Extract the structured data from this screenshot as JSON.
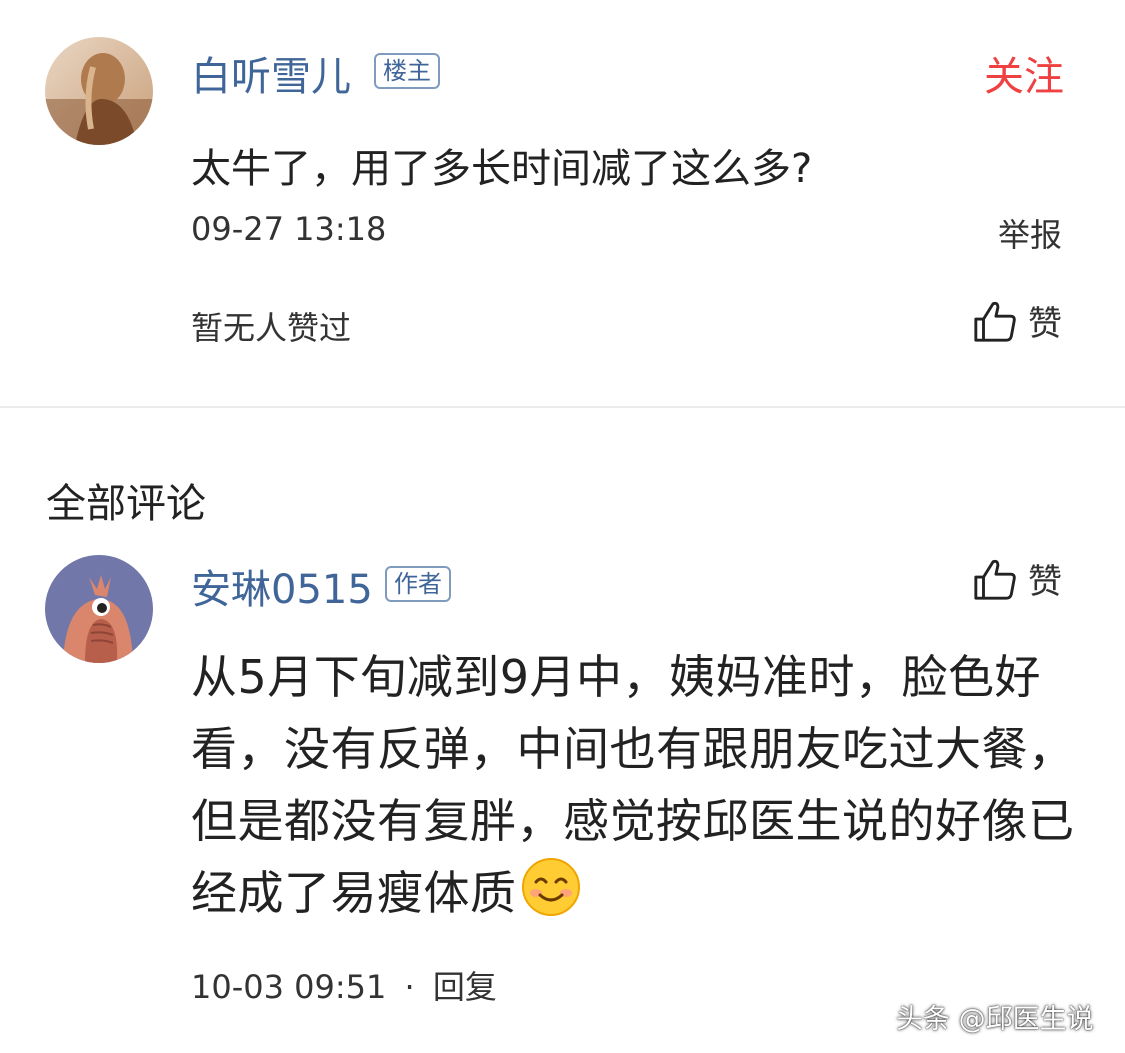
{
  "original_comment": {
    "author": "白听雪儿",
    "badge": "楼主",
    "follow_label": "关注",
    "text": "太牛了，用了多长时间减了这么多?",
    "timestamp": "09-27 13:18",
    "report_label": "举报",
    "likes_text": "暂无人赞过",
    "like_label": "赞"
  },
  "section_title": "全部评论",
  "reply": {
    "author": "安琳0515",
    "badge": "作者",
    "like_label": "赞",
    "text": "从5月下旬减到9月中，姨妈准时，脸色好看，没有反弹，中间也有跟朋友吃过大餐，但是都没有复胖，感觉按邱医生说的好像已经成了易瘦体质",
    "emoji": "smiling-face-emoji",
    "timestamp": "10-03 09:51",
    "separator": "·",
    "reply_label": "回复"
  },
  "watermark": "头条 @邱医生说",
  "colors": {
    "name_blue": "#406599",
    "follow_red": "#f04142",
    "text": "#222222"
  }
}
